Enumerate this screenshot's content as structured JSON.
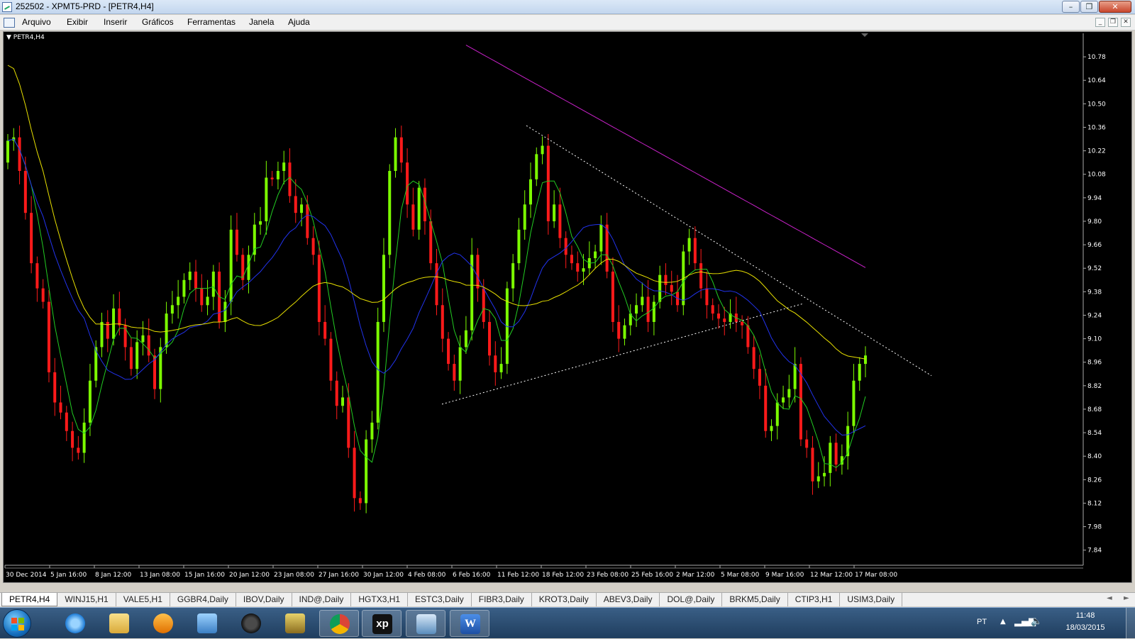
{
  "window": {
    "title": "252502 - XPMT5-PRD - [PETR4,H4]",
    "minimize": "–",
    "maximize": "❐",
    "close": "✕"
  },
  "menu": [
    "Arquivo",
    "Exibir",
    "Inserir",
    "Gráficos",
    "Ferramentas",
    "Janela",
    "Ajuda"
  ],
  "mdi_buttons": [
    "_",
    "❐",
    "✕"
  ],
  "chart": {
    "label": "▼ PETR4,H4",
    "colors": {
      "background": "#000000",
      "bull": "#7cfc00",
      "bear": "#ff1a1a",
      "ma_fast": "#22cc22",
      "ma_mid": "#2233ee",
      "ma_slow": "#e8e000",
      "ma_long": "#cc22cc",
      "trendline": "#ffffff"
    }
  },
  "tabs": [
    "PETR4,H4",
    "WINJ15,H1",
    "VALE5,H1",
    "GGBR4,Daily",
    "IBOV,Daily",
    "IND@,Daily",
    "HGTX3,H1",
    "ESTC3,Daily",
    "FIBR3,Daily",
    "KROT3,Daily",
    "ABEV3,Daily",
    "DOL@,Daily",
    "BRKM5,Daily",
    "CTIP3,H1",
    "USIM3,Daily"
  ],
  "tab_nav": [
    "◄",
    "►"
  ],
  "taskbar": {
    "apps": [
      "internet-explorer",
      "windows-explorer",
      "media-player",
      "network-tool",
      "hp",
      "archive",
      "chrome",
      "xp",
      "metatrader",
      "word"
    ],
    "xp_label": "xp",
    "word_label": "W",
    "lang": "PT",
    "time": "11:48",
    "date": "18/03/2015"
  },
  "chart_data": {
    "type": "candlestick",
    "symbol": "PETR4",
    "timeframe": "H4",
    "y_ticks": [
      10.78,
      10.64,
      10.5,
      10.36,
      10.22,
      10.08,
      9.94,
      9.8,
      9.66,
      9.52,
      9.38,
      9.24,
      9.1,
      8.96,
      8.82,
      8.68,
      8.54,
      8.4,
      8.26,
      8.12,
      7.98,
      7.84
    ],
    "ylim": [
      7.75,
      10.92
    ],
    "x_tick_labels": [
      "30 Dec 2014",
      "5 Jan 16:00",
      "8 Jan 12:00",
      "13 Jan 08:00",
      "15 Jan 16:00",
      "20 Jan 12:00",
      "23 Jan 08:00",
      "27 Jan 16:00",
      "30 Jan 12:00",
      "4 Feb 08:00",
      "6 Feb 16:00",
      "11 Feb 12:00",
      "18 Feb 12:00",
      "23 Feb 08:00",
      "25 Feb 16:00",
      "2 Mar 12:00",
      "5 Mar 08:00",
      "9 Mar 16:00",
      "12 Mar 12:00",
      "17 Mar 08:00"
    ],
    "closes": [
      10.28,
      10.3,
      10.1,
      9.85,
      9.55,
      9.4,
      9.32,
      8.9,
      8.72,
      8.66,
      8.55,
      8.45,
      8.42,
      8.6,
      8.85,
      9.05,
      9.2,
      9.1,
      9.28,
      9.18,
      9.05,
      8.92,
      9.08,
      9.12,
      9.0,
      8.8,
      9.05,
      9.25,
      9.3,
      9.35,
      9.45,
      9.5,
      9.4,
      9.3,
      9.35,
      9.5,
      9.2,
      9.32,
      9.75,
      9.6,
      9.45,
      9.6,
      9.78,
      9.8,
      10.06,
      10.05,
      10.1,
      10.15,
      9.95,
      9.85,
      9.9,
      9.7,
      9.6,
      9.2,
      9.1,
      8.85,
      8.7,
      8.75,
      8.45,
      8.15,
      8.12,
      8.5,
      8.6,
      9.2,
      9.6,
      10.1,
      10.3,
      10.15,
      9.9,
      9.75,
      10.0,
      9.8,
      9.55,
      9.3,
      9.1,
      8.95,
      8.85,
      9.05,
      9.15,
      9.6,
      9.4,
      9.2,
      9.0,
      8.9,
      8.95,
      9.4,
      9.55,
      9.75,
      9.9,
      10.05,
      10.2,
      10.25,
      9.8,
      9.9,
      9.7,
      9.6,
      9.55,
      9.5,
      9.52,
      9.58,
      9.62,
      9.78,
      9.5,
      9.2,
      9.1,
      9.18,
      9.25,
      9.3,
      9.35,
      9.2,
      9.32,
      9.48,
      9.42,
      9.38,
      9.3,
      9.62,
      9.7,
      9.55,
      9.4,
      9.3,
      9.25,
      9.22,
      9.2,
      9.25,
      9.2,
      9.18,
      9.05,
      8.92,
      8.82,
      8.55,
      8.58,
      8.72,
      8.75,
      8.8,
      8.95,
      8.5,
      8.45,
      8.25,
      8.28,
      8.3,
      8.48,
      8.35,
      8.4,
      8.58,
      8.85,
      8.95,
      9.0
    ]
  }
}
